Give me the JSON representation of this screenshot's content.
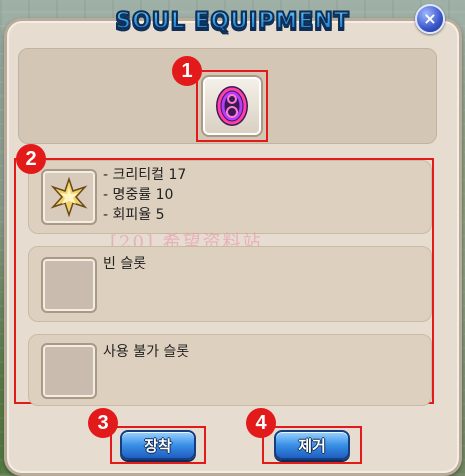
{
  "window": {
    "title": "SOUL EQUIPMENT",
    "close_label": "×"
  },
  "callouts": [
    "1",
    "2",
    "3",
    "4"
  ],
  "soul_item": {
    "icon": "purple-soul-ring-icon"
  },
  "slots": [
    {
      "state": "filled",
      "icon": "gold-star-emblem-icon",
      "lines": [
        "- 크리티컬 17",
        "- 명중률 10",
        "- 회피율 5"
      ]
    },
    {
      "state": "empty",
      "label": "빈 슬롯"
    },
    {
      "state": "disabled",
      "label": "사용 불가 슬롯"
    }
  ],
  "buttons": {
    "equip": "장착",
    "remove": "제거"
  },
  "watermark": "[20] 希望资料站",
  "colors": {
    "callout": "#e31a1a",
    "button": "#3a8fe6",
    "panel": "#e6ddd0"
  }
}
